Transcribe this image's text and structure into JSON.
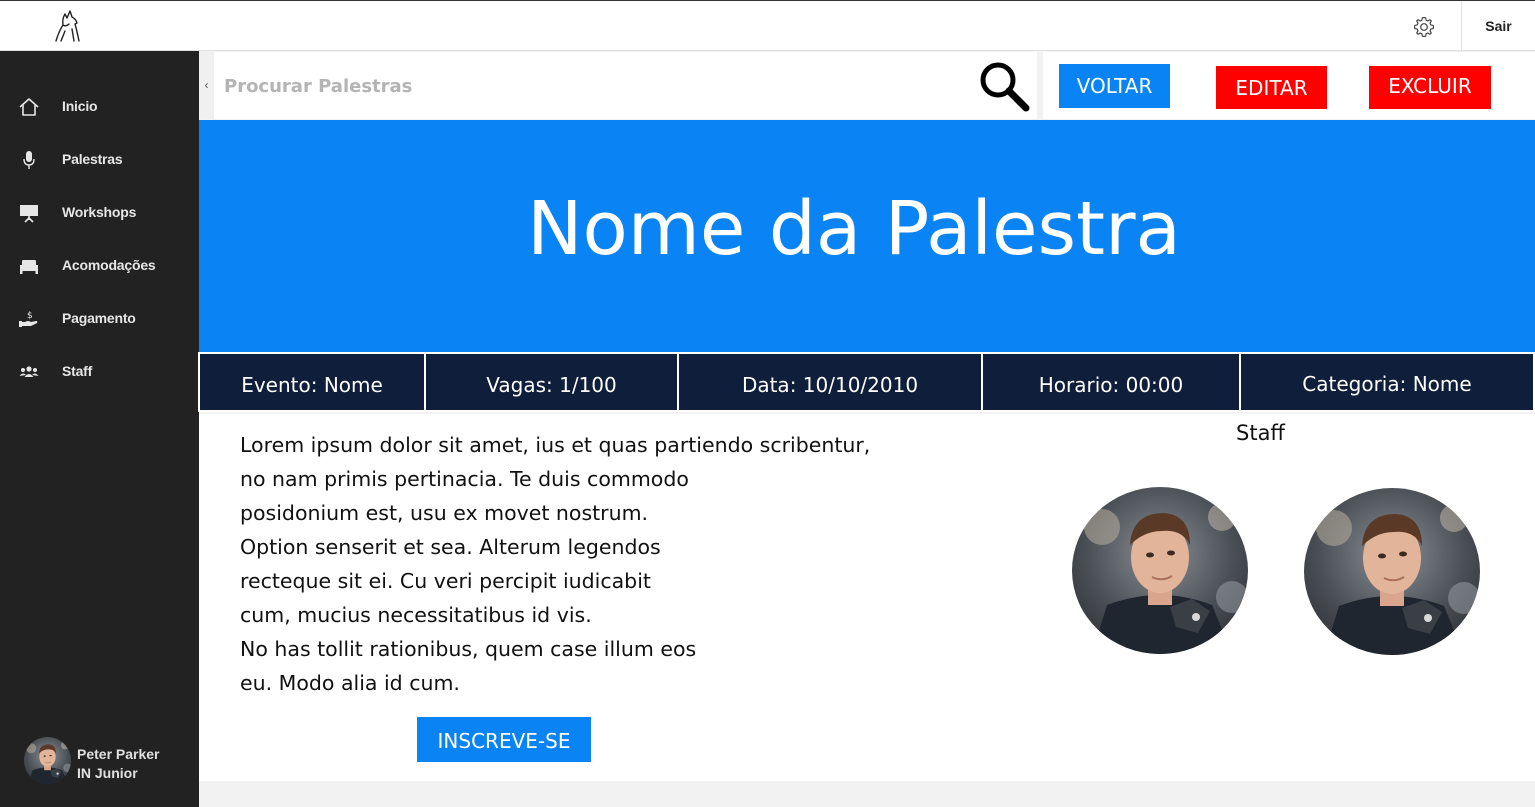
{
  "topbar": {
    "logo_icon": "wolf-howl-logo-icon",
    "settings_icon": "gear-icon",
    "logout_label": "Sair"
  },
  "sidebar": {
    "items": [
      {
        "label": "Inicio",
        "icon": "home-icon"
      },
      {
        "label": "Palestras",
        "icon": "microphone-icon"
      },
      {
        "label": "Workshops",
        "icon": "presentation-board-icon"
      },
      {
        "label": "Acomodações",
        "icon": "bed-icon"
      },
      {
        "label": "Pagamento",
        "icon": "payment-hand-icon"
      },
      {
        "label": "Staff",
        "icon": "group-icon"
      }
    ],
    "user": {
      "name": "Peter Parker",
      "role": "IN Junior"
    }
  },
  "search": {
    "placeholder": "Procurar Palestras",
    "value": ""
  },
  "actions": {
    "back_label": "VOLTAR",
    "edit_label": "EDITAR",
    "delete_label": "EXCLUIR"
  },
  "talk": {
    "title": "Nome da Palestra",
    "info": [
      "Evento: Nome",
      "Vagas: 1/100",
      "Data: 10/10/2010",
      "Horario: 00:00",
      "Categoria: Nome"
    ],
    "description": "Lorem ipsum dolor sit amet, ius et quas partiendo scribentur,\nno nam primis pertinacia. Te duis commodo\n posidonium est, usu ex movet nostrum.\nOption senserit et sea. Alterum legendos\nrecteque sit ei. Cu veri percipit iudicabit\ncum, mucius necessitatibus id vis.\nNo has tollit rationibus, quem case illum eos\neu. Modo alia id cum.",
    "subscribe_label": "INSCREVE-SE",
    "staff_title": "Staff"
  },
  "colors": {
    "primary": "#0a84f5",
    "danger": "#ff0000",
    "sidebar": "#222222",
    "info_strip": "#0f1e3a"
  }
}
